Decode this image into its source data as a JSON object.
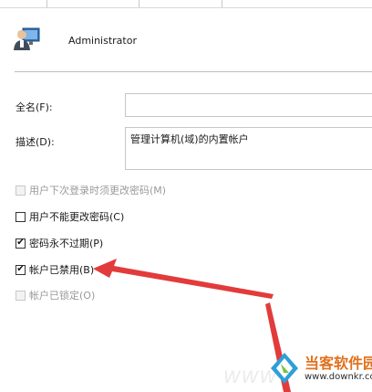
{
  "user": {
    "name": "Administrator",
    "icon": "user-account-icon"
  },
  "fields": {
    "fullname_label": "全名(F):",
    "fullname_value": "",
    "description_label": "描述(D):",
    "description_value": "管理计算机(域)的内置帐户"
  },
  "options": [
    {
      "label": "用户下次登录时须更改密码(M)",
      "checked": false,
      "enabled": false
    },
    {
      "label": "用户不能更改密码(C)",
      "checked": false,
      "enabled": true
    },
    {
      "label": "密码永不过期(P)",
      "checked": true,
      "enabled": true
    },
    {
      "label": "帐户已禁用(B)",
      "checked": true,
      "enabled": true
    },
    {
      "label": "帐户已锁定(O)",
      "checked": false,
      "enabled": false
    }
  ],
  "watermark": {
    "title": "当客软件园",
    "url": "www.downkr.com",
    "letters": "WWW"
  },
  "colors": {
    "annotation_arrow": "#e23b3b",
    "watermark_accent": "#e0711d"
  }
}
